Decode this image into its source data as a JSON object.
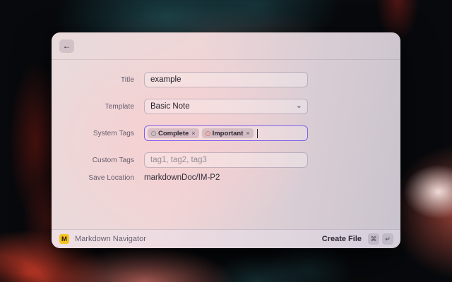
{
  "colors": {
    "focus_border": "#7c62ee",
    "app_icon_bg": "#f6c41f",
    "tag_complete_circle": "#87948d",
    "tag_important_circle": "#db7e6f"
  },
  "window": {
    "back_icon": "←"
  },
  "form": {
    "fields": [
      {
        "label": "Title",
        "value": "example"
      },
      {
        "label": "Template",
        "value": "Basic Note",
        "chevron_icon": "⌄"
      },
      {
        "label": "System Tags",
        "tags": [
          {
            "name": "Complete",
            "remove_icon": "×",
            "color": "#87948d"
          },
          {
            "name": "Important",
            "remove_icon": "×",
            "color": "#db7e6f"
          }
        ]
      },
      {
        "label": "Custom Tags",
        "placeholder": "tag1, tag2, tag3"
      },
      {
        "label": "Save Location",
        "value": "markdownDoc/IM-P2"
      }
    ]
  },
  "footer": {
    "app_icon_letter": "M",
    "app_name": "Markdown Navigator",
    "action_label": "Create File",
    "shortcut_keys": [
      "⌘",
      "↵"
    ]
  }
}
